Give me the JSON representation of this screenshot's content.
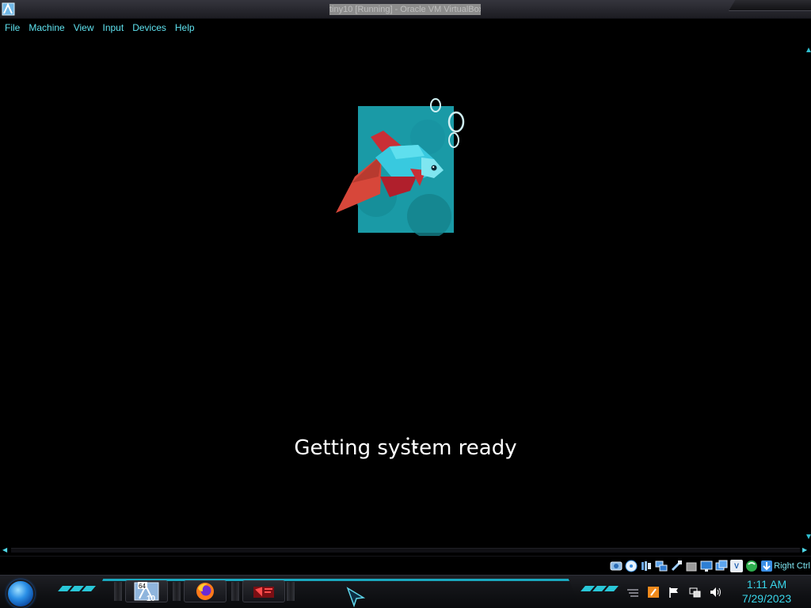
{
  "window": {
    "title": "tiny10 [Running] - Oracle VM VirtualBox"
  },
  "menubar": {
    "items": [
      "File",
      "Machine",
      "View",
      "Input",
      "Devices",
      "Help"
    ]
  },
  "guest": {
    "status_text": "Getting system ready"
  },
  "statusbar": {
    "icons": [
      "hard-disk-icon",
      "optical-drive-icon",
      "audio-icon",
      "network-icon",
      "usb-icon",
      "shared-folders-icon",
      "display-icon",
      "recording-icon",
      "vt-x-icon",
      "mouse-integration-icon",
      "keyboard-capture-icon"
    ],
    "host_key": "Right Ctrl"
  },
  "taskbar": {
    "tasks": [
      {
        "name": "virtualbox",
        "icon": "virtualbox-icon",
        "badge_top": "64",
        "badge_bottom": "10"
      },
      {
        "name": "firefox",
        "icon": "firefox-icon"
      },
      {
        "name": "media-app",
        "icon": "media-app-icon"
      }
    ],
    "tray_icons": [
      "tray-menu-icon",
      "tray-app-icon",
      "action-center-flag-icon",
      "network-tray-icon",
      "volume-icon"
    ],
    "clock": {
      "time": "1:11 AM",
      "date": "7/29/2023"
    }
  },
  "colors": {
    "accent": "#29c7d8",
    "menu_text": "#5fe3f0",
    "fish_bg": "#1a9aa6"
  }
}
